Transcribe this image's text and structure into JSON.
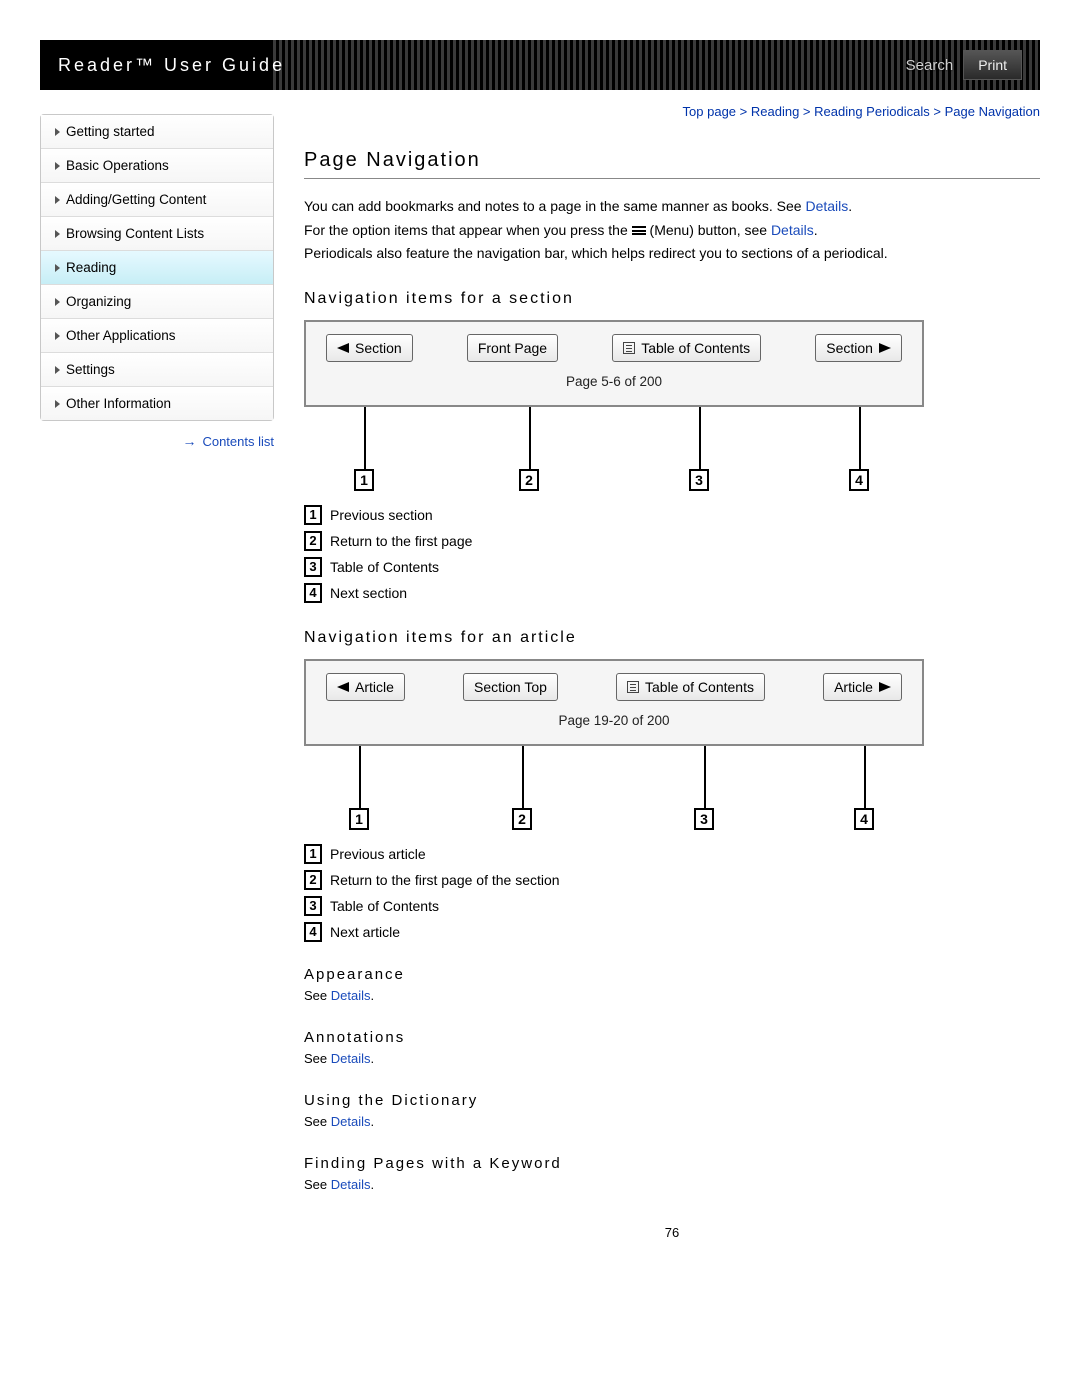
{
  "header": {
    "title": "Reader™ User Guide",
    "search_label": "Search",
    "print_label": "Print"
  },
  "breadcrumb": {
    "items": [
      "Top page",
      "Reading",
      "Reading Periodicals",
      "Page Navigation"
    ]
  },
  "sidebar": {
    "items": [
      {
        "label": "Getting started",
        "active": false
      },
      {
        "label": "Basic Operations",
        "active": false
      },
      {
        "label": "Adding/Getting Content",
        "active": false
      },
      {
        "label": "Browsing Content Lists",
        "active": false
      },
      {
        "label": "Reading",
        "active": true
      },
      {
        "label": "Organizing",
        "active": false
      },
      {
        "label": "Other Applications",
        "active": false
      },
      {
        "label": "Settings",
        "active": false
      },
      {
        "label": "Other Information",
        "active": false
      }
    ],
    "contents_link": "Contents list"
  },
  "content": {
    "title": "Page Navigation",
    "intro1_a": "You can add bookmarks and notes to a page in the same manner as books. See ",
    "intro1_link": "Details",
    "intro1_b": ".",
    "intro2_a": "For the option items that appear when you press the ",
    "intro2_b": " (Menu) button, see ",
    "intro2_link": "Details",
    "intro2_c": ".",
    "intro3": "Periodicals also feature the navigation bar, which helps redirect you to sections of a periodical.",
    "section1": {
      "heading": "Navigation items for a section",
      "bar": {
        "prev": "Section",
        "first": "Front Page",
        "toc": "Table of Contents",
        "next": "Section",
        "pageinfo": "Page 5-6 of 200"
      },
      "legend": [
        {
          "n": "1",
          "txt": "Previous section"
        },
        {
          "n": "2",
          "txt": "Return to the first page"
        },
        {
          "n": "3",
          "txt": "Table of Contents"
        },
        {
          "n": "4",
          "txt": "Next section"
        }
      ]
    },
    "section2": {
      "heading": "Navigation items for an article",
      "bar": {
        "prev": "Article",
        "first": "Section Top",
        "toc": "Table of Contents",
        "next": "Article",
        "pageinfo": "Page 19-20 of 200"
      },
      "legend": [
        {
          "n": "1",
          "txt": "Previous article"
        },
        {
          "n": "2",
          "txt": "Return to the first page of the section"
        },
        {
          "n": "3",
          "txt": "Table of Contents"
        },
        {
          "n": "4",
          "txt": "Next article"
        }
      ]
    },
    "subsections": [
      {
        "heading": "Appearance",
        "see": "See ",
        "link": "Details",
        "dot": "."
      },
      {
        "heading": "Annotations",
        "see": "See ",
        "link": "Details",
        "dot": "."
      },
      {
        "heading": "Using the Dictionary",
        "see": "See ",
        "link": "Details",
        "dot": "."
      },
      {
        "heading": "Finding Pages with a Keyword",
        "see": "See ",
        "link": "Details",
        "dot": "."
      }
    ],
    "page_number": "76"
  }
}
